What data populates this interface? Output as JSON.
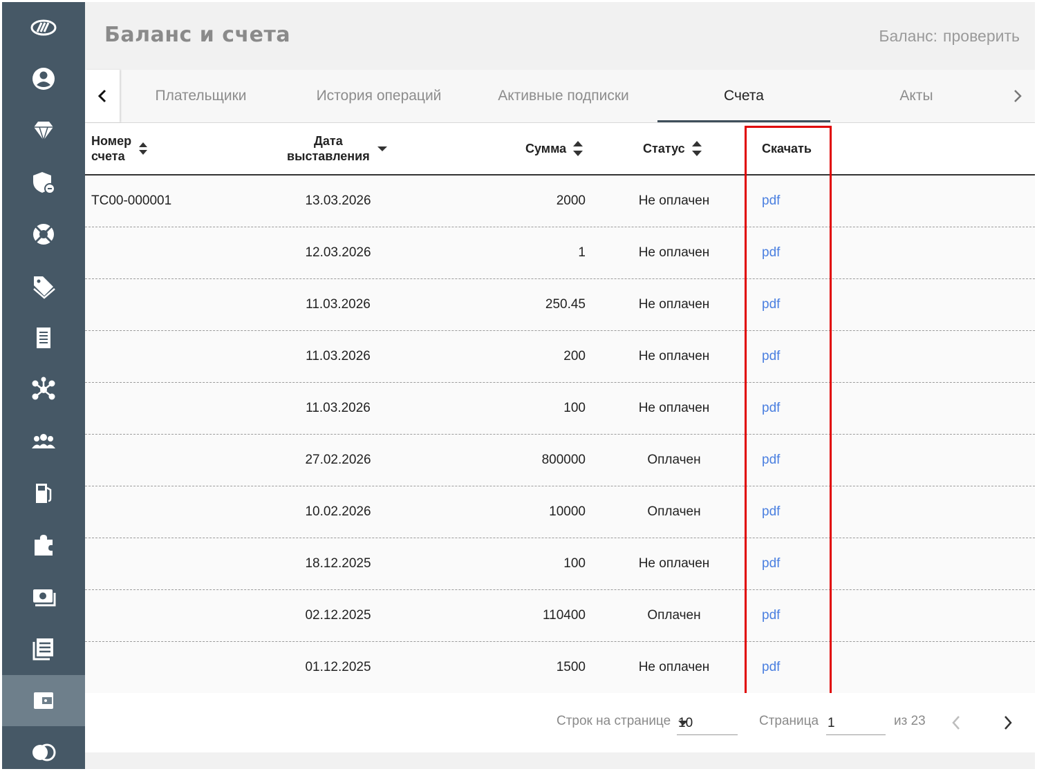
{
  "header": {
    "title": "Баланс и счета",
    "balance_label": "Баланс:",
    "balance_link": "проверить"
  },
  "sidebar": {
    "items": [
      {
        "icon": "logo-icon"
      },
      {
        "icon": "user-icon"
      },
      {
        "icon": "diamond-icon"
      },
      {
        "icon": "shield-icon"
      },
      {
        "icon": "lifebuoy-icon"
      },
      {
        "icon": "tags-icon"
      },
      {
        "icon": "receipt-icon"
      },
      {
        "icon": "network-icon"
      },
      {
        "icon": "users-icon"
      },
      {
        "icon": "fuel-icon"
      },
      {
        "icon": "puzzle-icon"
      },
      {
        "icon": "money-icon"
      },
      {
        "icon": "list-icon"
      },
      {
        "icon": "wallet-icon",
        "active": true
      },
      {
        "icon": "circles-icon"
      }
    ]
  },
  "tabs": {
    "items": [
      "Плательщики",
      "История операций",
      "Активные подписки",
      "Счета",
      "Акты"
    ],
    "active": "Счета"
  },
  "table": {
    "columns": {
      "number_l1": "Номер",
      "number_l2": "счета",
      "date_l1": "Дата",
      "date_l2": "выставления",
      "sum": "Сумма",
      "status": "Статус",
      "download": "Скачать"
    },
    "rows": [
      {
        "number": "ТС00-000001",
        "date": "13.03.2026",
        "sum": "2000",
        "status": "Не оплачен",
        "link": "pdf"
      },
      {
        "number": "",
        "date": "12.03.2026",
        "sum": "1",
        "status": "Не оплачен",
        "link": "pdf"
      },
      {
        "number": "",
        "date": "11.03.2026",
        "sum": "250.45",
        "status": "Не оплачен",
        "link": "pdf"
      },
      {
        "number": "",
        "date": "11.03.2026",
        "sum": "200",
        "status": "Не оплачен",
        "link": "pdf"
      },
      {
        "number": "",
        "date": "11.03.2026",
        "sum": "100",
        "status": "Не оплачен",
        "link": "pdf"
      },
      {
        "number": "",
        "date": "27.02.2026",
        "sum": "800000",
        "status": "Оплачен",
        "link": "pdf"
      },
      {
        "number": "",
        "date": "10.02.2026",
        "sum": "10000",
        "status": "Оплачен",
        "link": "pdf"
      },
      {
        "number": "",
        "date": "18.12.2025",
        "sum": "100",
        "status": "Не оплачен",
        "link": "pdf"
      },
      {
        "number": "",
        "date": "02.12.2025",
        "sum": "110400",
        "status": "Оплачен",
        "link": "pdf"
      },
      {
        "number": "",
        "date": "01.12.2025",
        "sum": "1500",
        "status": "Не оплачен",
        "link": "pdf"
      }
    ]
  },
  "pagination": {
    "rows_label": "Строк на странице",
    "rows_value": "10",
    "page_label": "Страница",
    "page_value": "1",
    "of_label": "из 23"
  },
  "colors": {
    "sidebar": "#465866",
    "sidebar_active": "#6e7f8b",
    "link": "#4a7fe0",
    "highlight": "#e00000"
  }
}
